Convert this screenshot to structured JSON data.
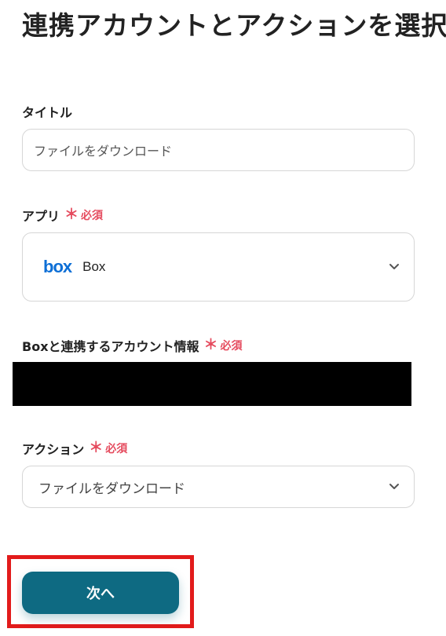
{
  "page": {
    "title": "連携アカウントとアクションを選択"
  },
  "fields": {
    "title": {
      "label": "タイトル",
      "value": "ファイルをダウンロード"
    },
    "app": {
      "label": "アプリ",
      "required_mark": "＊",
      "required_text": "必須",
      "logo_text": "box",
      "value": "Box",
      "icon": "chevron-down-icon"
    },
    "account": {
      "label": "Boxと連携するアカウント情報",
      "required_mark": "＊",
      "required_text": "必須"
    },
    "action": {
      "label": "アクション",
      "required_mark": "＊",
      "required_text": "必須",
      "value": "ファイルをダウンロード",
      "icon": "chevron-down-icon"
    }
  },
  "buttons": {
    "next_label": "次へ"
  },
  "colors": {
    "required": "#e54b5e",
    "primary_button": "#0e6a82",
    "box_brand": "#0d6fd6",
    "highlight": "#e21b1b"
  }
}
